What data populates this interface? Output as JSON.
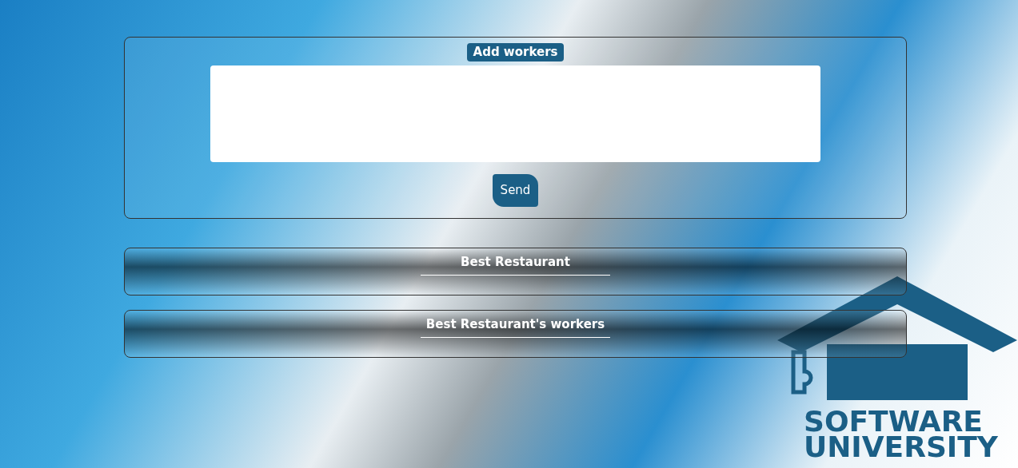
{
  "add_panel": {
    "title": "Add workers",
    "button": "Send"
  },
  "sections": [
    {
      "title": "Best Restaurant"
    },
    {
      "title": "Best Restaurant's workers"
    }
  ],
  "logo": {
    "line_1": "SOFTWARE",
    "line_2": "UNIVERSITY"
  }
}
